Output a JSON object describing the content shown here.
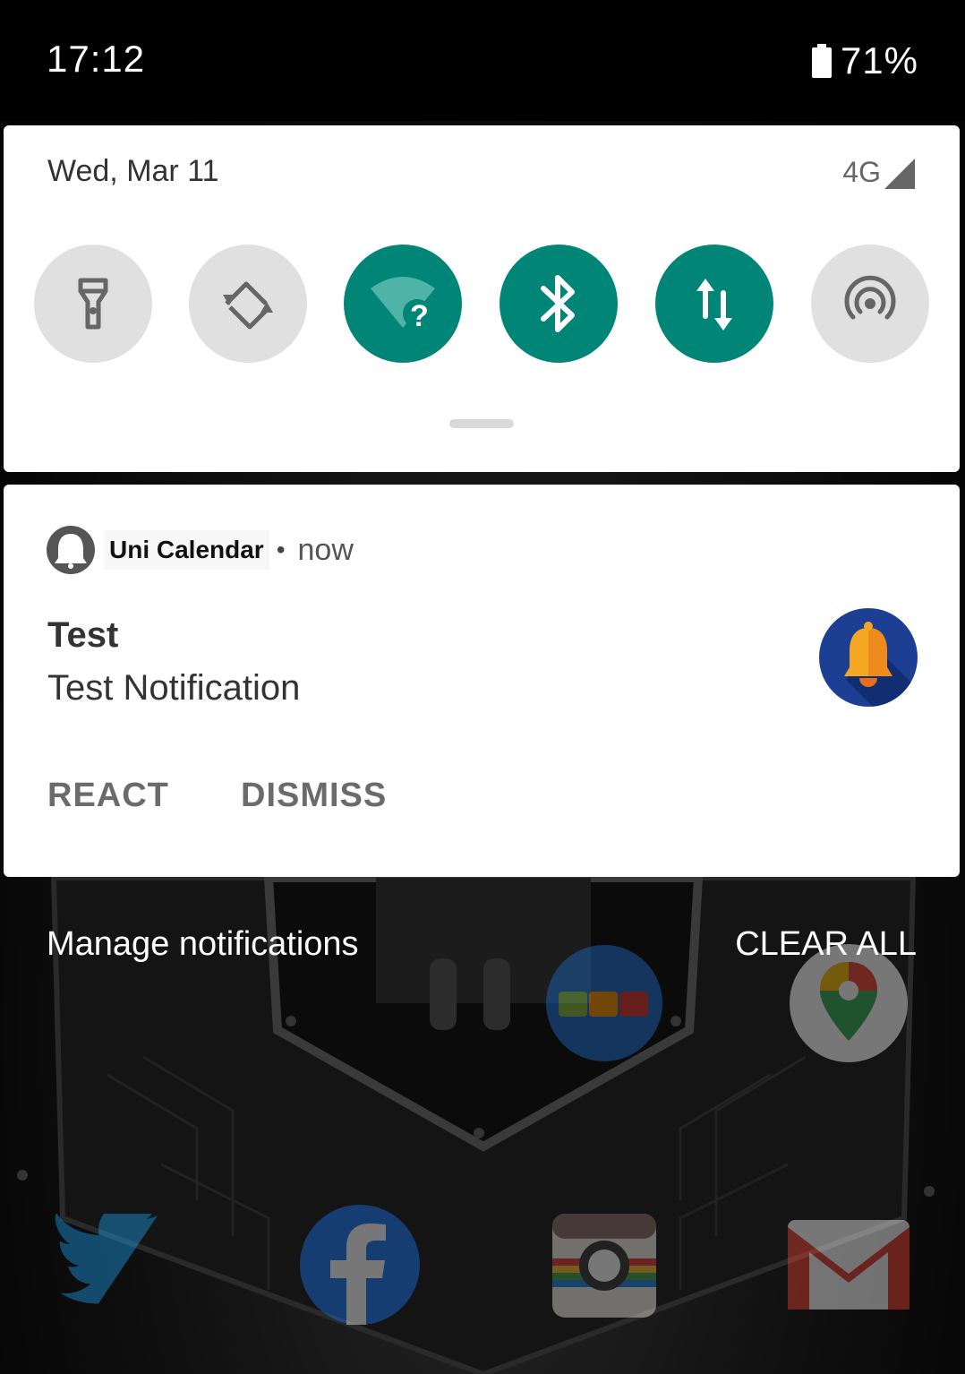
{
  "status_bar": {
    "time": "17:12",
    "battery": "71%"
  },
  "quick_settings": {
    "date": "Wed, Mar 11",
    "network": "4G",
    "tiles": [
      {
        "icon": "flashlight-icon",
        "state": "off"
      },
      {
        "icon": "auto-rotate-icon",
        "state": "off"
      },
      {
        "icon": "wifi-icon",
        "state": "on"
      },
      {
        "icon": "bluetooth-icon",
        "state": "on"
      },
      {
        "icon": "mobile-data-icon",
        "state": "on"
      },
      {
        "icon": "hotspot-icon",
        "state": "off"
      }
    ],
    "accent_color": "#008577"
  },
  "notification": {
    "app_name": "Uni Calendar",
    "separator": "•",
    "time": "now",
    "title": "Test",
    "text": "Test Notification",
    "large_icon": "bell-icon",
    "actions": [
      "REACT",
      "DISMISS"
    ]
  },
  "footer": {
    "manage": "Manage notifications",
    "clear_all": "CLEAR ALL"
  },
  "home_screen_icons": [
    "twitter-icon",
    "facebook-icon",
    "camera-icon",
    "gmail-icon",
    "abc-puzzle-icon",
    "maps-icon"
  ]
}
